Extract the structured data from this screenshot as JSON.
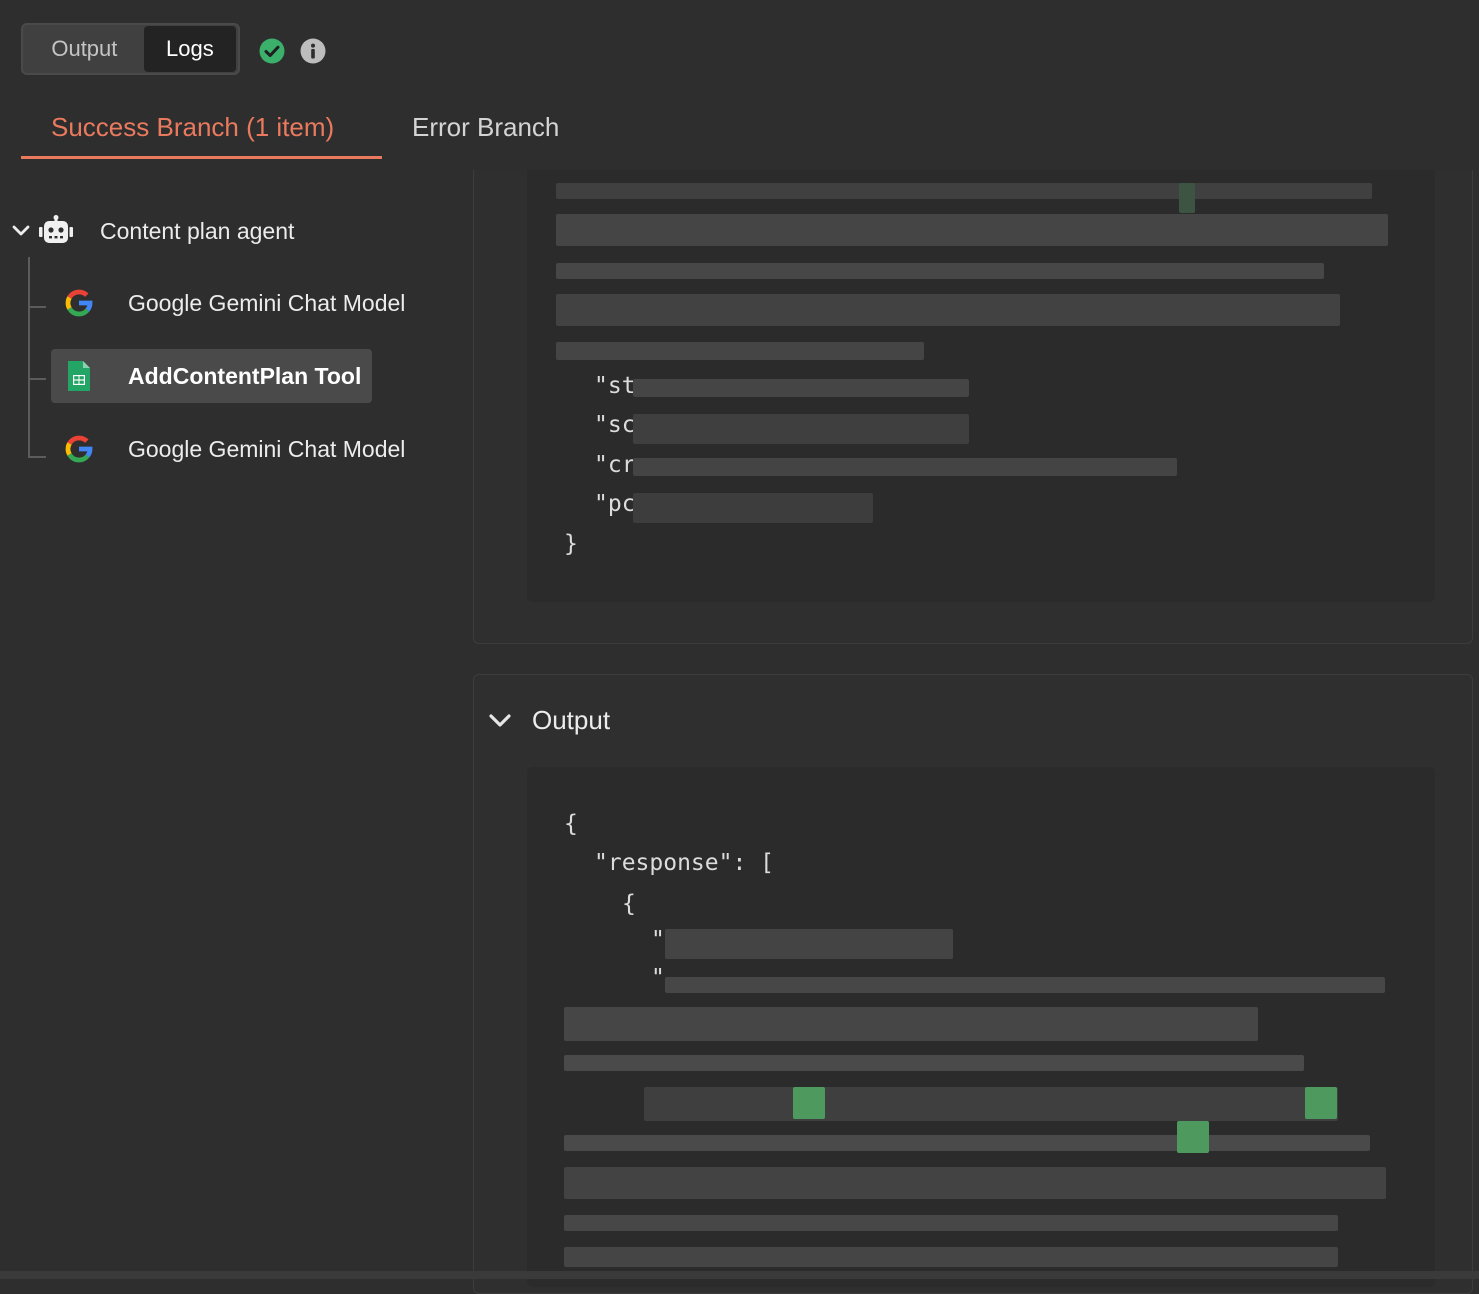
{
  "view_toggle": {
    "output_label": "Output",
    "logs_label": "Logs",
    "active": "Logs"
  },
  "status": {
    "success_icon": "check-circle-icon",
    "info_icon": "info-icon",
    "success_color": "#3bb06b"
  },
  "branch_tabs": [
    {
      "label": "Success Branch (1 item)",
      "active": true
    },
    {
      "label": "Error Branch",
      "active": false
    }
  ],
  "accent_color": "#ea7a5e",
  "tree": {
    "root": {
      "label": "Content plan agent",
      "icon": "robot-icon",
      "expanded": true
    },
    "children": [
      {
        "label": "Google Gemini Chat Model",
        "icon": "google-icon",
        "active": false
      },
      {
        "label": "AddContentPlan Tool",
        "icon": "google-sheets-icon",
        "active": true
      },
      {
        "label": "Google Gemini Chat Model",
        "icon": "google-icon",
        "active": false
      }
    ]
  },
  "input_panel": {
    "code_lines": {
      "key1": "\"st",
      "key2": "\"sc",
      "key3": "\"cr",
      "key4": "\"pc",
      "close": "}"
    }
  },
  "output_panel": {
    "title": "Output",
    "expanded": true,
    "code_lines": {
      "open": "{",
      "response": "\"response\": [",
      "obj_open": "{",
      "q1": "\"",
      "q2": "\""
    }
  }
}
